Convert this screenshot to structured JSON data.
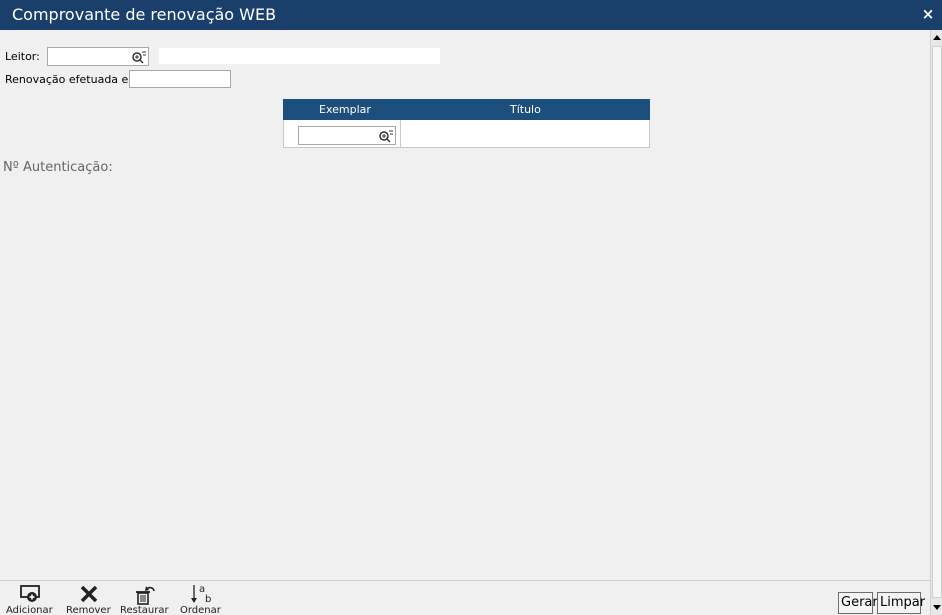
{
  "window": {
    "title": "Comprovante de renovação WEB",
    "close_label": "×"
  },
  "form": {
    "leitor_label": "Leitor:",
    "leitor_value": "",
    "leitor_desc": "",
    "renovacao_label": "Renovação efetuada em:",
    "renovacao_value": ""
  },
  "grid": {
    "columns": [
      "Exemplar",
      "Título"
    ],
    "row": {
      "exemplar": "",
      "titulo": ""
    }
  },
  "auth": {
    "label": "Nº Autenticação:"
  },
  "toolbar": {
    "items": [
      {
        "label": "Adicionar",
        "icon": "add-icon"
      },
      {
        "label": "Remover",
        "icon": "remove-icon"
      },
      {
        "label": "Restaurar",
        "icon": "restore-icon"
      },
      {
        "label": "Ordenar",
        "icon": "sort-icon"
      }
    ]
  },
  "actions": {
    "gerar_label": "Gerar",
    "limpar_label": "Limpar"
  },
  "colors": {
    "titlebar": "#1b3f6b",
    "grid_header": "#1c4f7c",
    "background": "#f0f0f0"
  }
}
